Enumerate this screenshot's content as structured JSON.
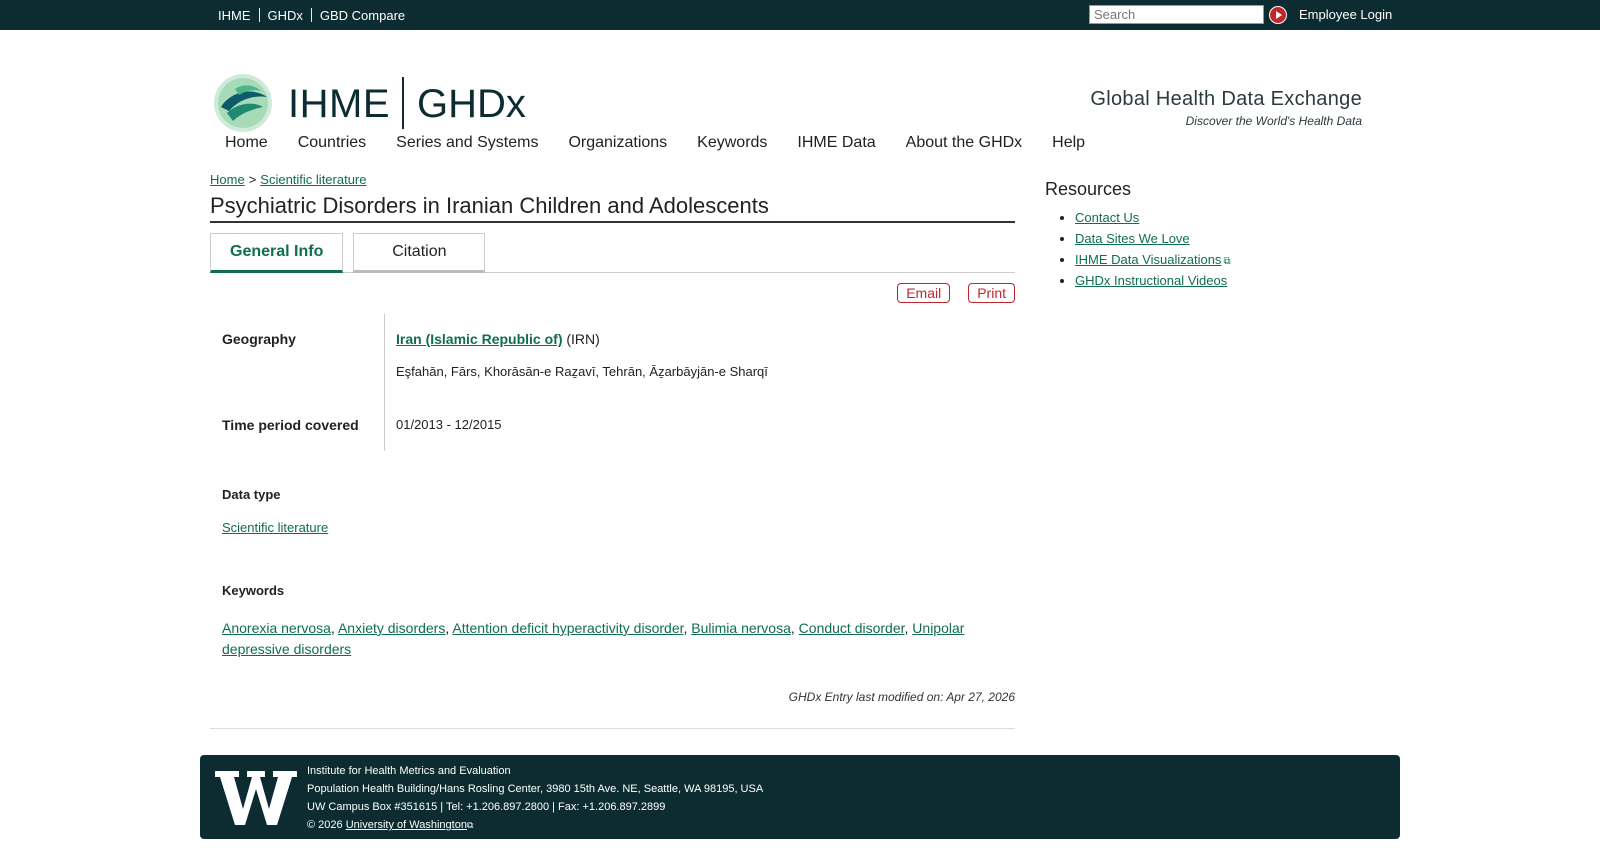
{
  "topbar": {
    "links": [
      "IHME",
      "GHDx",
      "GBD Compare"
    ],
    "search_placeholder": "Search",
    "login": "Employee Login"
  },
  "header": {
    "logo_ihme": "IHME",
    "logo_ghdx": "GHDx",
    "tagline_title": "Global Health Data Exchange",
    "tagline_sub": "Discover the World's Health Data"
  },
  "nav": [
    "Home",
    "Countries",
    "Series and Systems",
    "Organizations",
    "Keywords",
    "IHME Data",
    "About the GHDx",
    "Help"
  ],
  "breadcrumb": {
    "home": "Home",
    "sep": ">",
    "current": "Scientific literature"
  },
  "page": {
    "title": "Psychiatric Disorders in Iranian Children and Adolescents",
    "tabs": [
      "General Info",
      "Citation"
    ],
    "actions": {
      "email": "Email",
      "print": "Print"
    }
  },
  "fields": {
    "geography_label": "Geography",
    "geography_country": "Iran (Islamic Republic of)",
    "geography_code": "(IRN)",
    "geography_regions": "Eşfahān, Fārs, Khorāsān-e Raẕavī, Tehrān, Āẕarbāyjān-e Sharqī",
    "time_label": "Time period covered",
    "time_value": "01/2013 - 12/2015",
    "datatype_label": "Data type",
    "datatype_value": "Scientific literature",
    "keywords_label": "Keywords",
    "keywords": [
      "Anorexia nervosa",
      "Anxiety disorders",
      "Attention deficit hyperactivity disorder",
      "Bulimia nervosa",
      "Conduct disorder",
      "Unipolar depressive disorders"
    ],
    "modified": "GHDx Entry last modified on: Apr 27, 2026"
  },
  "sidebar": {
    "title": "Resources",
    "links": [
      "Contact Us",
      "Data Sites We Love",
      "IHME Data Visualizations",
      "GHDx Instructional Videos"
    ]
  },
  "footer": {
    "line1": "Institute for Health Metrics and Evaluation",
    "line2": "Population Health Building/Hans Rosling Center, 3980 15th Ave. NE, Seattle, WA 98195, USA",
    "line3": "UW Campus Box #351615 | Tel: +1.206.897.2800 | Fax: +1.206.897.2899",
    "copyright": "© 2026",
    "uw_link": "University of Washington"
  },
  "colors": {
    "dark": "#0d2c31",
    "link": "#0f6e4d",
    "accent_red": "#c0272d"
  }
}
